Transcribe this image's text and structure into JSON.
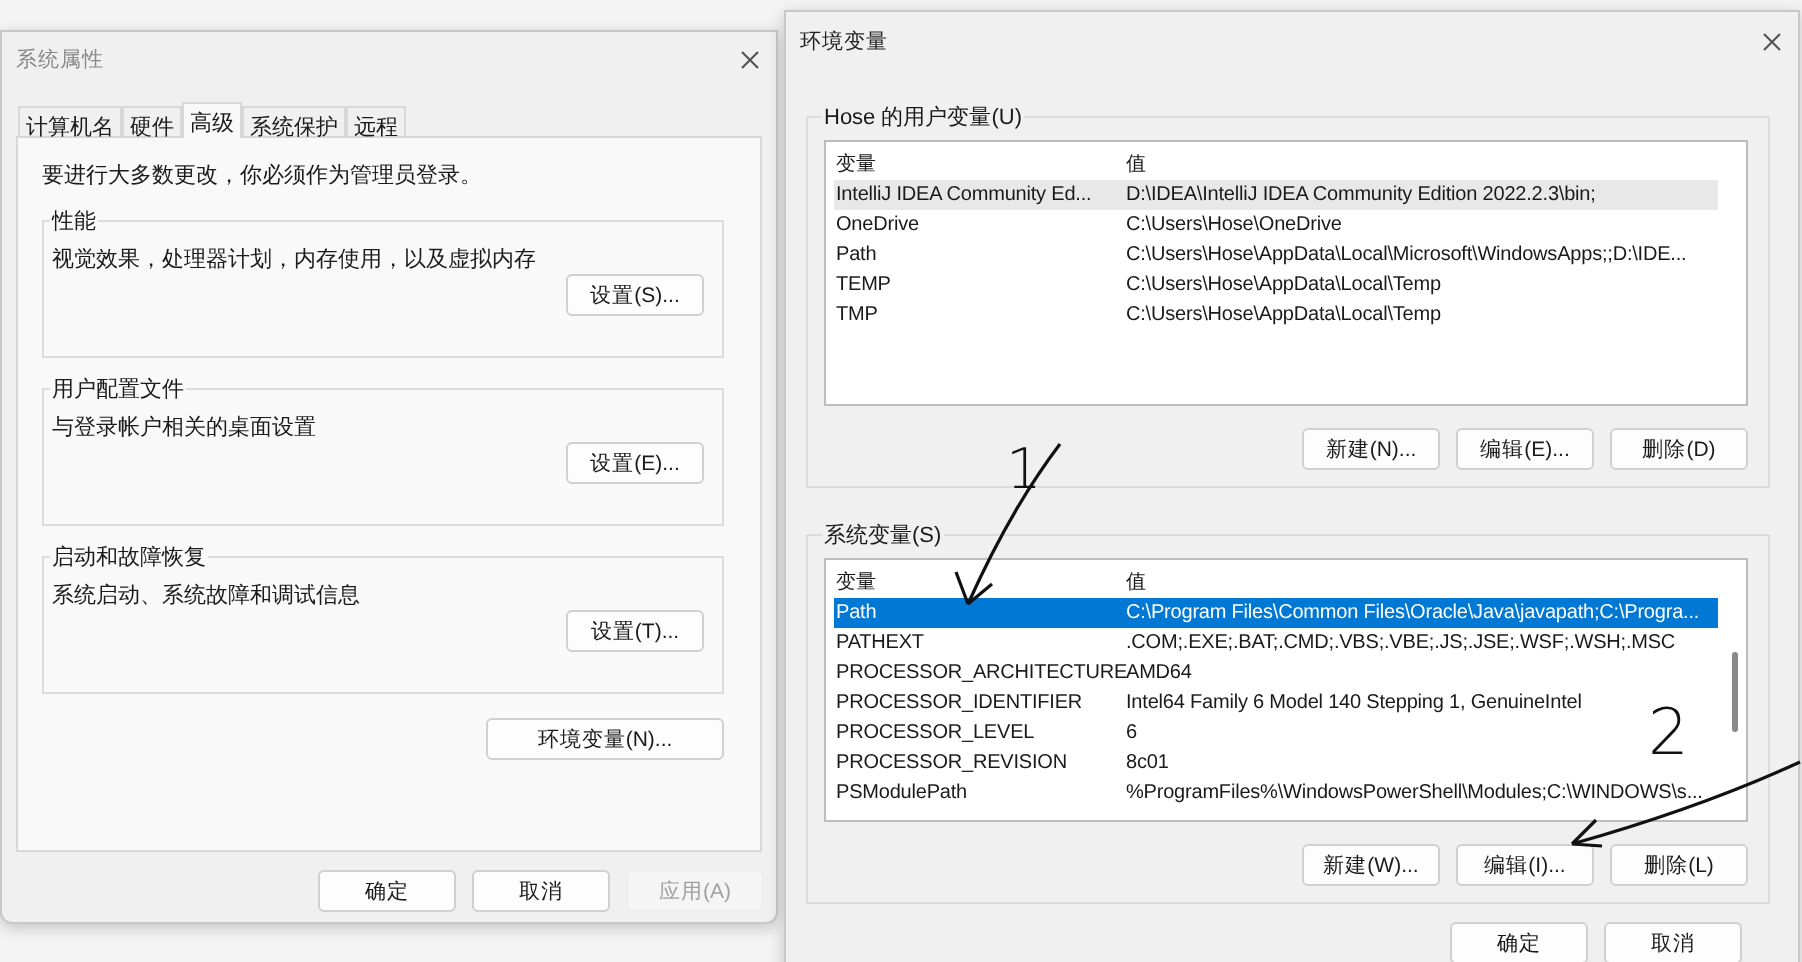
{
  "system_properties": {
    "title": "系统属性",
    "tabs": [
      {
        "label": "计算机名",
        "selected": false
      },
      {
        "label": "硬件",
        "selected": false
      },
      {
        "label": "高级",
        "selected": true
      },
      {
        "label": "系统保护",
        "selected": false
      },
      {
        "label": "远程",
        "selected": false
      }
    ],
    "admin_note": "要进行大多数更改，你必须作为管理员登录。",
    "groups": [
      {
        "title": "性能",
        "description": "视觉效果，处理器计划，内存使用，以及虚拟内存",
        "button": "设置(S)..."
      },
      {
        "title": "用户配置文件",
        "description": "与登录帐户相关的桌面设置",
        "button": "设置(E)..."
      },
      {
        "title": "启动和故障恢复",
        "description": "系统启动、系统故障和调试信息",
        "button": "设置(T)..."
      }
    ],
    "env_button": "环境变量(N)...",
    "footer_buttons": [
      {
        "label": "确定",
        "disabled": false
      },
      {
        "label": "取消",
        "disabled": false
      },
      {
        "label": "应用(A)",
        "disabled": true
      }
    ]
  },
  "environment_variables": {
    "title": "环境变量",
    "user_variables": {
      "title": "Hose 的用户变量(U)",
      "focused": false,
      "columns": [
        "变量",
        "值"
      ],
      "rows": [
        {
          "name": "IntelliJ IDEA Community Ed...",
          "value": "D:\\IDEA\\IntelliJ IDEA Community Edition 2022.2.3\\bin;",
          "selected": true
        },
        {
          "name": "OneDrive",
          "value": "C:\\Users\\Hose\\OneDrive",
          "selected": false
        },
        {
          "name": "Path",
          "value": "C:\\Users\\Hose\\AppData\\Local\\Microsoft\\WindowsApps;;D:\\IDE...",
          "selected": false
        },
        {
          "name": "TEMP",
          "value": "C:\\Users\\Hose\\AppData\\Local\\Temp",
          "selected": false
        },
        {
          "name": "TMP",
          "value": "C:\\Users\\Hose\\AppData\\Local\\Temp",
          "selected": false
        }
      ],
      "buttons": [
        "新建(N)...",
        "编辑(E)...",
        "删除(D)"
      ]
    },
    "system_variables": {
      "title": "系统变量(S)",
      "focused": true,
      "columns": [
        "变量",
        "值"
      ],
      "rows": [
        {
          "name": "Path",
          "value": "C:\\Program Files\\Common Files\\Oracle\\Java\\javapath;C:\\Progra...",
          "selected": true
        },
        {
          "name": "PATHEXT",
          "value": ".COM;.EXE;.BAT;.CMD;.VBS;.VBE;.JS;.JSE;.WSF;.WSH;.MSC",
          "selected": false
        },
        {
          "name": "PROCESSOR_ARCHITECTURE",
          "value": "AMD64",
          "selected": false
        },
        {
          "name": "PROCESSOR_IDENTIFIER",
          "value": "Intel64 Family 6 Model 140 Stepping 1, GenuineIntel",
          "selected": false
        },
        {
          "name": "PROCESSOR_LEVEL",
          "value": "6",
          "selected": false
        },
        {
          "name": "PROCESSOR_REVISION",
          "value": "8c01",
          "selected": false
        },
        {
          "name": "PSModulePath",
          "value": "%ProgramFiles%\\WindowsPowerShell\\Modules;C:\\WINDOWS\\s...",
          "selected": false
        }
      ],
      "buttons": [
        "新建(W)...",
        "编辑(I)...",
        "删除(L)"
      ]
    },
    "footer_buttons": [
      "确定",
      "取消"
    ]
  },
  "annotations": [
    {
      "text": "1"
    },
    {
      "text": "2"
    }
  ]
}
